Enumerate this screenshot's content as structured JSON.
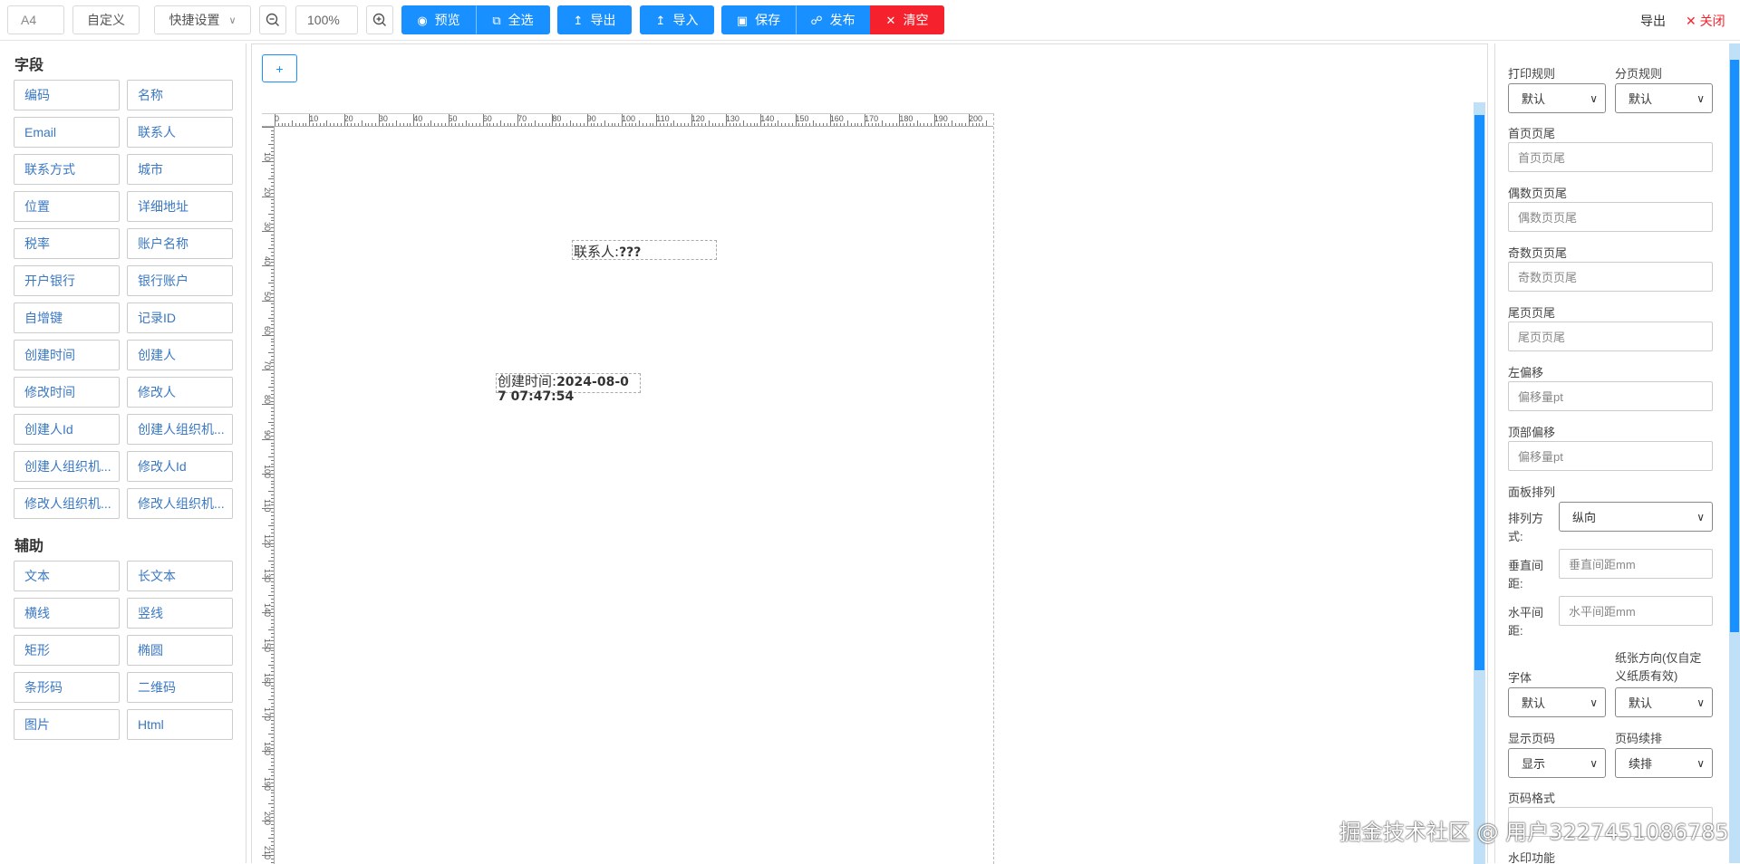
{
  "toolbar": {
    "paper_size": "A4",
    "custom": "自定义",
    "quick_settings": "快捷设置",
    "zoom": "100%",
    "preview": "预览",
    "select_all": "全选",
    "export": "导出",
    "import": "导入",
    "save": "保存",
    "publish": "发布",
    "clear": "清空",
    "right_export": "导出",
    "close": "关闭"
  },
  "left": {
    "fields_title": "字段",
    "fields": [
      "编码",
      "名称",
      "Email",
      "联系人",
      "联系方式",
      "城市",
      "位置",
      "详细地址",
      "税率",
      "账户名称",
      "开户银行",
      "银行账户",
      "自增键",
      "记录ID",
      "创建时间",
      "创建人",
      "修改时间",
      "修改人",
      "创建人Id",
      "创建人组织机...",
      "创建人组织机...",
      "修改人Id",
      "修改人组织机...",
      "修改人组织机..."
    ],
    "aux_title": "辅助",
    "aux": [
      "文本",
      "长文本",
      "横线",
      "竖线",
      "矩形",
      "椭圆",
      "条形码",
      "二维码",
      "图片",
      "Html"
    ]
  },
  "canvas": {
    "add_button": "+",
    "ruler_top": [
      "0",
      "10",
      "20",
      "30",
      "40",
      "50",
      "60",
      "70",
      "80",
      "90",
      "100",
      "110",
      "120",
      "130",
      "140",
      "150",
      "160",
      "170",
      "180",
      "190",
      "200"
    ],
    "ruler_left": [
      "10",
      "20",
      "30",
      "40",
      "50",
      "60",
      "70",
      "80",
      "90",
      "100",
      "110",
      "120",
      "130",
      "140",
      "150",
      "160",
      "170",
      "180",
      "190",
      "200",
      "210"
    ],
    "contact_label": "联系人:",
    "contact_value": "???",
    "created_label": "创建时间:",
    "created_value_1": "2024-08-0",
    "created_value_2": "7 07:47:54"
  },
  "right": {
    "print_rule_label": "打印规则",
    "print_rule_value": "默认",
    "page_rule_label": "分页规则",
    "page_rule_value": "默认",
    "first_footer_label": "首页页尾",
    "first_footer_placeholder": "首页页尾",
    "even_footer_label": "偶数页页尾",
    "even_footer_placeholder": "偶数页页尾",
    "odd_footer_label": "奇数页页尾",
    "odd_footer_placeholder": "奇数页页尾",
    "last_footer_label": "尾页页尾",
    "last_footer_placeholder": "尾页页尾",
    "left_offset_label": "左偏移",
    "left_offset_placeholder": "偏移量pt",
    "top_offset_label": "顶部偏移",
    "top_offset_placeholder": "偏移量pt",
    "panel_arrange_label": "面板排列",
    "arrange_mode_label_1": "排列方",
    "arrange_mode_label_2": "式:",
    "arrange_mode_value": "纵向",
    "vgap_label_1": "垂直间",
    "vgap_label_2": "距:",
    "vgap_placeholder": "垂直间距mm",
    "hgap_label_1": "水平间",
    "hgap_label_2": "距:",
    "hgap_placeholder": "水平间距mm",
    "font_label": "字体",
    "font_value": "默认",
    "orientation_label_1": "纸张方向(仅自定",
    "orientation_label_2": "义纸质有效)",
    "orientation_value": "默认",
    "show_page_no_label": "显示页码",
    "show_page_no_value": "显示",
    "page_continue_label": "页码续排",
    "page_continue_value": "续排",
    "page_format_label": "页码格式",
    "watermark_label": "水印功能"
  },
  "watermark_text": "掘金技术社区 @ 用户3227451086785",
  "colors": {
    "primary": "#1890ff",
    "danger": "#f5222d",
    "field_text": "#3a78c3"
  }
}
